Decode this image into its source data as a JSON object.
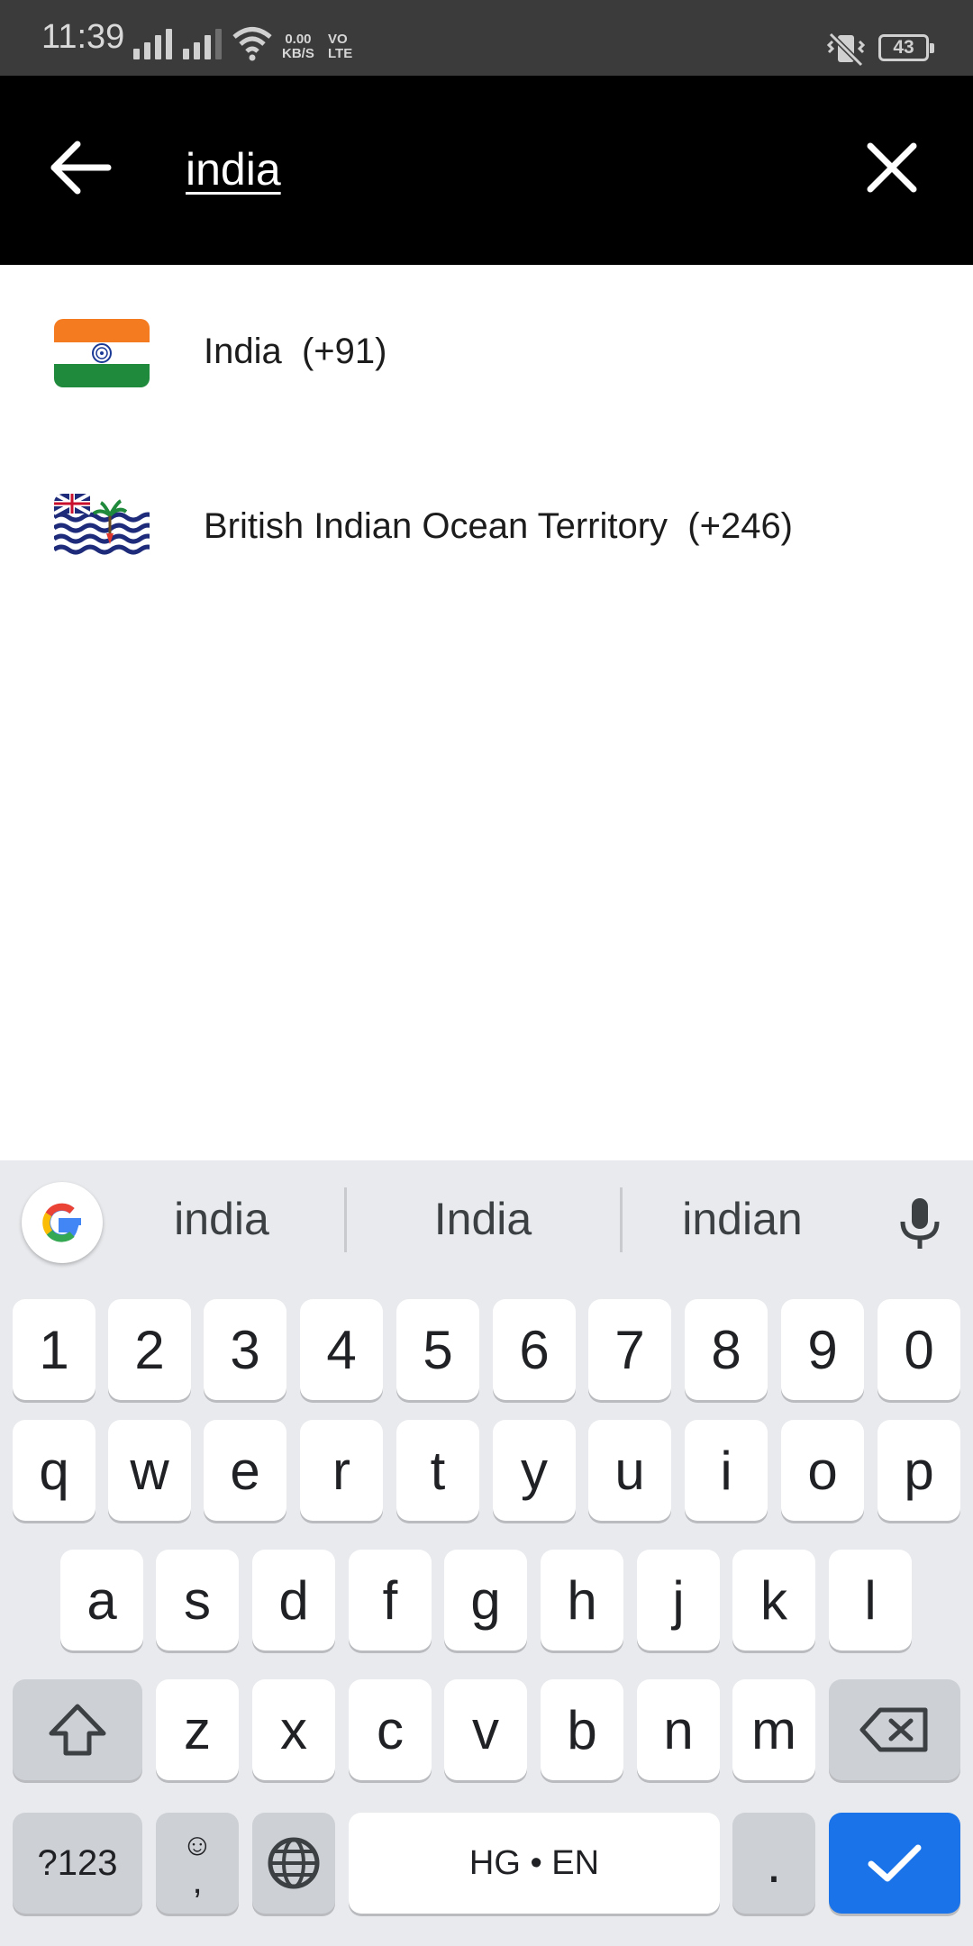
{
  "status_bar": {
    "time": "11:39",
    "net_speed_value": "0.00",
    "net_speed_unit": "KB/S",
    "volte_top": "VO",
    "volte_bottom": "LTE",
    "battery": "43"
  },
  "search": {
    "query": "india"
  },
  "results": [
    {
      "name": "India  (+91)",
      "flag": "india-flag"
    },
    {
      "name": "British Indian Ocean Territory  (+246)",
      "flag": "biot-flag"
    }
  ],
  "keyboard": {
    "suggestions": [
      "india",
      "India",
      "indian"
    ],
    "number_row": [
      "1",
      "2",
      "3",
      "4",
      "5",
      "6",
      "7",
      "8",
      "9",
      "0"
    ],
    "row1": [
      "q",
      "w",
      "e",
      "r",
      "t",
      "y",
      "u",
      "i",
      "o",
      "p"
    ],
    "row2": [
      "a",
      "s",
      "d",
      "f",
      "g",
      "h",
      "j",
      "k",
      "l"
    ],
    "row3": [
      "z",
      "x",
      "c",
      "v",
      "b",
      "n",
      "m"
    ],
    "symbols_key": "?123",
    "comma_key": ",",
    "emoji_key": "☺",
    "space_label": "HG • EN",
    "period_key": ".",
    "accent_color": "#1a73e8"
  }
}
